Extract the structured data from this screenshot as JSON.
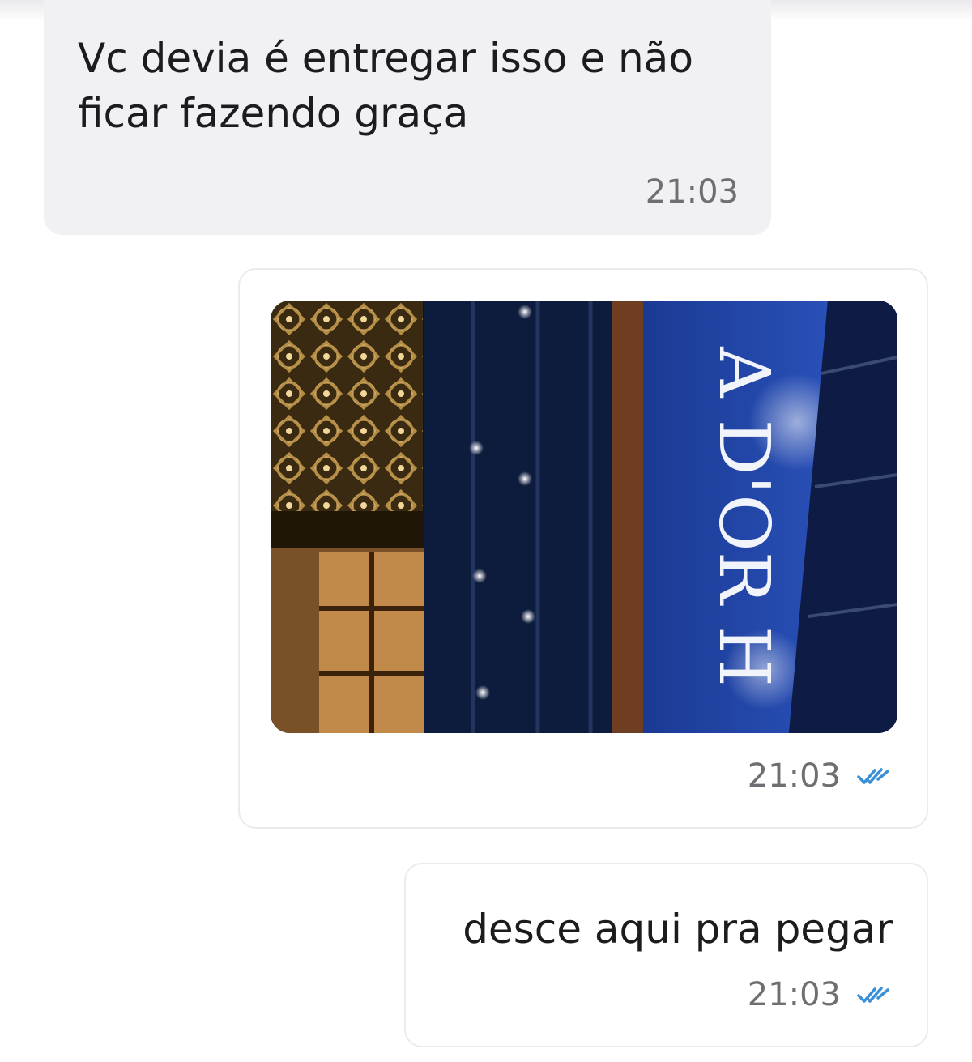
{
  "messages": [
    {
      "direction": "incoming",
      "text": "Vc devia é entregar isso e não ficar fazendo graça",
      "time": "21:03"
    },
    {
      "direction": "outgoing",
      "type": "image",
      "image_sign_text": "A D'OR H",
      "time": "21:03",
      "status_icon": "double-check-icon"
    },
    {
      "direction": "outgoing",
      "text": "desce aqui pra pegar",
      "time": "21:03",
      "status_icon": "double-check-icon"
    }
  ],
  "colors": {
    "incoming_bubble": "#f1f1f3",
    "outgoing_bubble": "#ffffff",
    "bubble_border": "#ebebee",
    "text": "#1c1c1e",
    "time": "#6f6f73",
    "check": "#3a8fd6",
    "sign_blue": "#1d3f9c"
  }
}
